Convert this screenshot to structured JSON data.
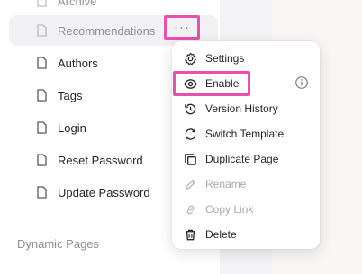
{
  "sidebar": {
    "items": [
      {
        "label": "Archive",
        "icon": "document-icon"
      },
      {
        "label": "Recommendations",
        "icon": "document-icon"
      },
      {
        "label": "Authors",
        "icon": "document-icon"
      },
      {
        "label": "Tags",
        "icon": "document-icon"
      },
      {
        "label": "Login",
        "icon": "document-icon"
      },
      {
        "label": "Reset Password",
        "icon": "document-icon"
      },
      {
        "label": "Update Password",
        "icon": "document-icon"
      }
    ],
    "more_label": "···",
    "section_title": "Dynamic Pages"
  },
  "menu": {
    "items": [
      {
        "label": "Settings",
        "icon": "gear-icon",
        "disabled": false
      },
      {
        "label": "Enable",
        "icon": "eye-icon",
        "disabled": false
      },
      {
        "label": "Version History",
        "icon": "history-icon",
        "disabled": false
      },
      {
        "label": "Switch Template",
        "icon": "switch-icon",
        "disabled": false
      },
      {
        "label": "Duplicate Page",
        "icon": "duplicate-icon",
        "disabled": false
      },
      {
        "label": "Rename",
        "icon": "pencil-icon",
        "disabled": true
      },
      {
        "label": "Copy Link",
        "icon": "link-icon",
        "disabled": true
      },
      {
        "label": "Delete",
        "icon": "trash-icon",
        "disabled": false
      }
    ]
  },
  "colors": {
    "highlight": "#ea4fae",
    "text": "#1f2330",
    "muted": "#8b8f99",
    "hover_bg": "#f1f1f3"
  }
}
